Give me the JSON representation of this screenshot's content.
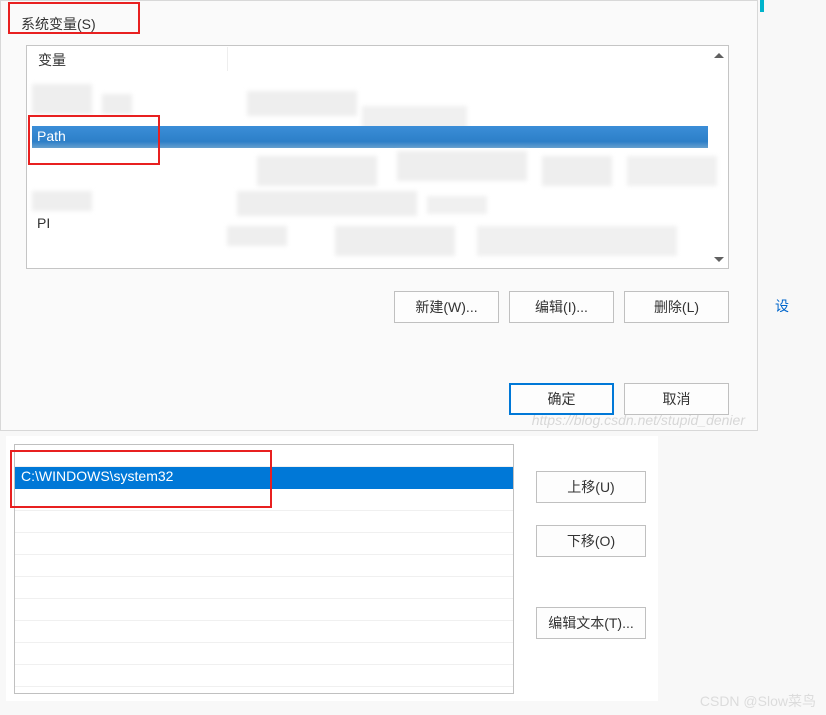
{
  "dialog": {
    "groupbox_title": "系统变量(S)",
    "header_variable": "变量",
    "selected_row": {
      "name": "Path"
    },
    "row_prefix": "PI",
    "buttons": {
      "new": "新建(W)...",
      "edit": "编辑(I)...",
      "delete": "删除(L)"
    },
    "footer": {
      "ok": "确定",
      "cancel": "取消"
    },
    "watermark": "https://blog.csdn.net/stupid_denier",
    "side_label": "设"
  },
  "editor": {
    "selected_value": "C:\\WINDOWS\\system32",
    "buttons": {
      "move_up": "上移(U)",
      "move_down": "下移(O)",
      "edit_text": "编辑文本(T)..."
    }
  },
  "watermark2": "CSDN @Slow菜鸟"
}
